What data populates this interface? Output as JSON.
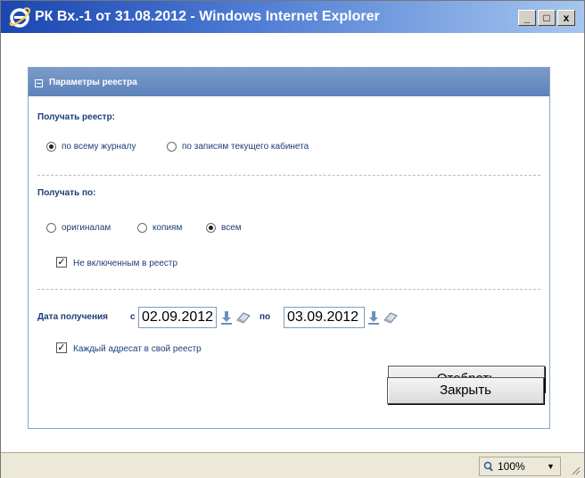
{
  "window": {
    "title": "РК Вх.-1 от 31.08.2012 - Windows Internet Explorer"
  },
  "controls": {
    "minimize": "_",
    "maximize": "□",
    "close": "x"
  },
  "panel": {
    "title": "Параметры реестра",
    "receive_registry": {
      "label": "Получать реестр:",
      "options": [
        "по всему журналу",
        "по записям текущего кабинета"
      ],
      "selected": "по всему журналу"
    },
    "receive_by": {
      "label": "Получать по:",
      "options": [
        "оригиналам",
        "копиям",
        "всем"
      ],
      "selected": "всем"
    },
    "not_included": {
      "label": "Не включенным в реестр",
      "checked": true
    },
    "date": {
      "label": "Дата получения",
      "from_label": "с",
      "from": "02.09.2012",
      "to_label": "по",
      "to": "03.09.2012"
    },
    "each_recipient": {
      "label": "Каждый адресат в свой реестр",
      "checked": true
    },
    "select_button": "Отобрать"
  },
  "close_button": "Закрыть",
  "status": {
    "zoom": "100%"
  }
}
